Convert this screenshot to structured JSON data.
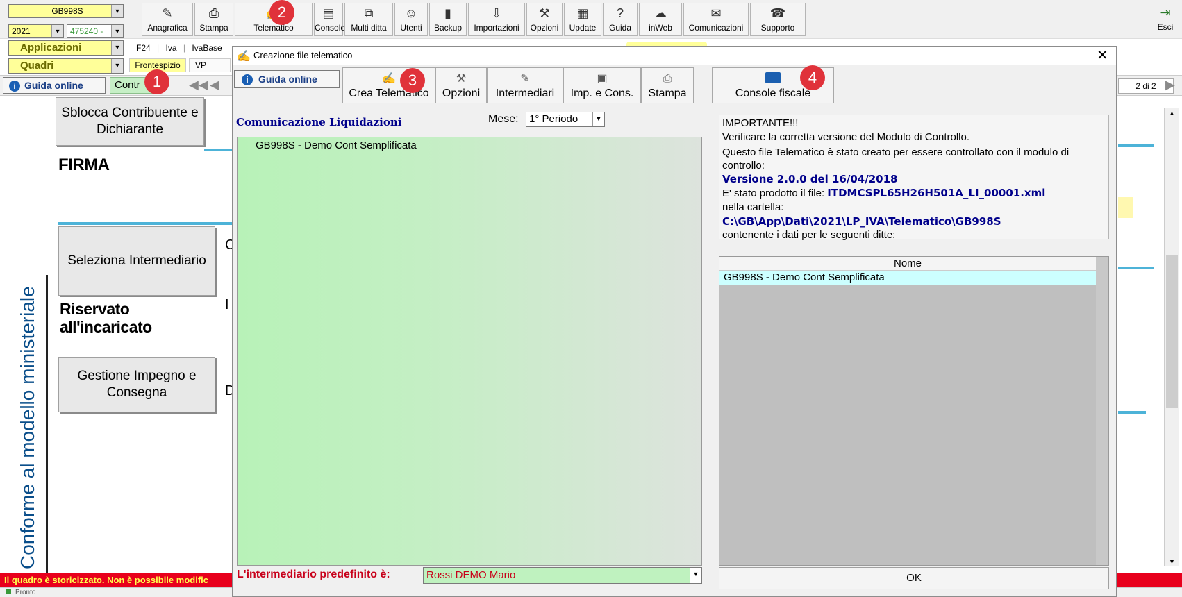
{
  "main": {
    "code_combo": "GB998S",
    "year_combo": "2021",
    "num_combo": "475240 -",
    "applicazioni": "Applicazioni",
    "quadri": "Quadri",
    "subnav": [
      "F24",
      "Iva",
      "IvaBase"
    ],
    "tabs": [
      "Frontespizio",
      "VP"
    ],
    "guida_online": "Guida online",
    "contr_tab": "Contr",
    "page_counter": "2 di 2",
    "toolbar": [
      {
        "label": "Anagrafica",
        "icon": "anagrafica-icon",
        "glyph": "✎"
      },
      {
        "label": "Stampa",
        "icon": "printer-icon",
        "glyph": "⎙"
      },
      {
        "label": "Telematico",
        "icon": "telematico-icon",
        "glyph": "✍"
      },
      {
        "label": "Console",
        "icon": "console-icon",
        "glyph": "▤"
      },
      {
        "label": "Multi ditta",
        "icon": "network-icon",
        "glyph": "⧉"
      },
      {
        "label": "Utenti",
        "icon": "users-icon",
        "glyph": "☺"
      },
      {
        "label": "Backup",
        "icon": "backup-icon",
        "glyph": "▮"
      },
      {
        "label": "Importazioni",
        "icon": "import-icon",
        "glyph": "⇩"
      },
      {
        "label": "Opzioni",
        "icon": "wrench-icon",
        "glyph": "⚒"
      },
      {
        "label": "Update",
        "icon": "update-icon",
        "glyph": "▦"
      },
      {
        "label": "Guida",
        "icon": "help-icon",
        "glyph": "?"
      },
      {
        "label": "inWeb",
        "icon": "cloud-icon",
        "glyph": "☁"
      },
      {
        "label": "Comunicazioni",
        "icon": "comunicazioni-icon",
        "glyph": "✉"
      },
      {
        "label": "Supporto",
        "icon": "support-icon",
        "glyph": "☎"
      }
    ],
    "esci": "Esci",
    "left_buttons": [
      "Sblocca Contribuente e Dichiarante",
      "Seleziona Intermediario",
      "Gestione Impegno e Consegna"
    ],
    "firma": "FIRMA",
    "riservato": "Riservato all'incaricato",
    "vertical_text": "Conforme al modello ministeriale",
    "partial_letters": [
      "C",
      "I",
      "D"
    ],
    "status_red": "Il quadro è storicizzato. Non è possibile modific",
    "status_bar": "Pronto"
  },
  "dialog": {
    "title": "Creazione file telematico",
    "guida_online": "Guida online",
    "buttons": [
      {
        "label": "Crea Telematico",
        "icon": "crea-telematico-icon",
        "glyph": "✍"
      },
      {
        "label": "Opzioni",
        "icon": "wrench-icon",
        "glyph": "⚒"
      },
      {
        "label": "Intermediari",
        "icon": "intermediari-icon",
        "glyph": "✎"
      },
      {
        "label": "Imp. e Cons.",
        "icon": "imp-cons-icon",
        "glyph": "▣"
      },
      {
        "label": "Stampa",
        "icon": "printer-icon",
        "glyph": "⎙"
      }
    ],
    "console_fiscale": "Console fiscale",
    "section_title": "Comunicazione Liquidazioni",
    "mese_label": "Mese:",
    "mese_value": "1° Periodo",
    "list_items": [
      "GB998S - Demo Cont Semplificata"
    ],
    "intermediario_label": "L'intermediario predefinito è:",
    "intermediario_value": "Rossi DEMO Mario",
    "info": {
      "l1": "IMPORTANTE!!!",
      "l2": "Verificare la corretta versione del Modulo di Controllo.",
      "l3": "Questo file Telematico è stato creato per essere controllato con il modulo di controllo:",
      "l4": "Versione 2.0.0 del 16/04/2018",
      "l5a": "E' stato prodotto il file: ",
      "l5b": "ITDMCSPL65H26H501A_LI_00001.xml",
      "l6": "nella cartella:",
      "l7": "C:\\GB\\App\\Dati\\2021\\LP_IVA\\Telematico\\GB998S",
      "l8": "contenente i dati per le seguenti ditte:"
    },
    "grid_header": "Nome",
    "grid_rows": [
      "GB998S - Demo Cont Semplificata"
    ],
    "ok": "OK"
  },
  "badges": [
    "1",
    "2",
    "3",
    "4"
  ]
}
